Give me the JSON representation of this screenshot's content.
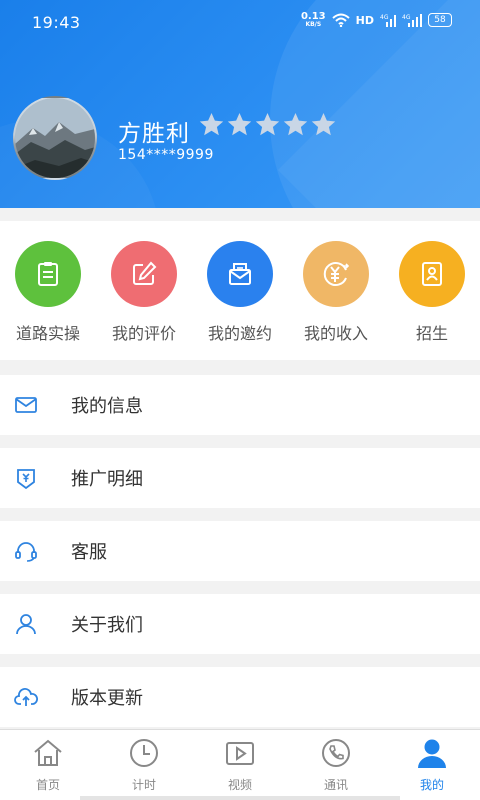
{
  "status_bar": {
    "time": "19:43",
    "net_speed_value": "0.13",
    "net_speed_unit": "KB/S",
    "hd": "HD",
    "signal1_label": "4G",
    "signal2_label": "4G",
    "battery": "58"
  },
  "profile": {
    "name": "方胜利",
    "phone": "154****9999",
    "rating_stars": 5
  },
  "quick_actions": [
    {
      "label": "道路实操",
      "icon": "clipboard-icon",
      "color": "#5ec13d"
    },
    {
      "label": "我的评价",
      "icon": "edit-icon",
      "color": "#ef6d72"
    },
    {
      "label": "我的邀约",
      "icon": "envelope-icon",
      "color": "#2a81ee"
    },
    {
      "label": "我的收入",
      "icon": "yuan-icon",
      "color": "#f0b766"
    },
    {
      "label": "招生",
      "icon": "id-card-icon",
      "color": "#f6b021"
    }
  ],
  "menu": [
    {
      "label": "我的信息",
      "icon": "mail-icon"
    },
    {
      "label": "推广明细",
      "icon": "promotion-icon"
    },
    {
      "label": "客服",
      "icon": "headset-icon"
    },
    {
      "label": "关于我们",
      "icon": "user-icon"
    },
    {
      "label": "版本更新",
      "icon": "cloud-upload-icon"
    }
  ],
  "tabs": [
    {
      "label": "首页",
      "icon": "home-icon"
    },
    {
      "label": "计时",
      "icon": "clock-icon"
    },
    {
      "label": "视频",
      "icon": "video-icon"
    },
    {
      "label": "通讯",
      "icon": "phone-icon"
    },
    {
      "label": "我的",
      "icon": "profile-icon",
      "active": true
    }
  ],
  "colors": {
    "header": "#1a7fea",
    "accent": "#1f83ea",
    "star": "#c9d6e6"
  }
}
